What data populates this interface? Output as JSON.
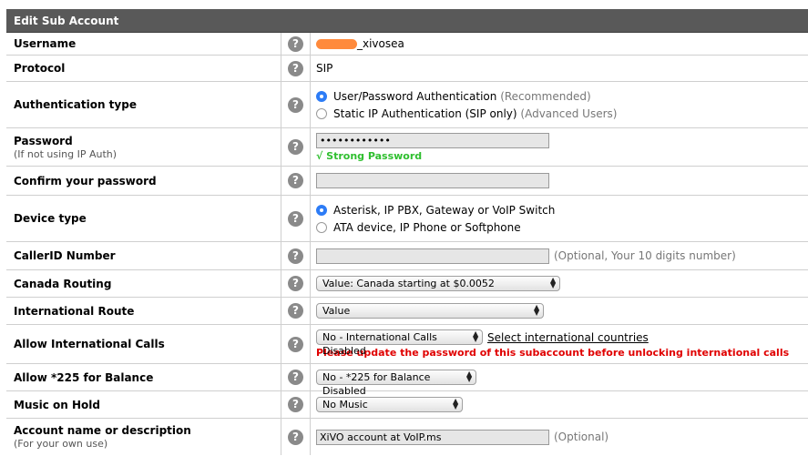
{
  "title": "Edit Sub Account",
  "rows": {
    "username": {
      "label": "Username",
      "value_suffix": "_xivosea"
    },
    "protocol": {
      "label": "Protocol",
      "value": "SIP"
    },
    "auth": {
      "label": "Authentication type",
      "option1": "User/Password Authentication",
      "option1_note": "(Recommended)",
      "option2": "Static IP Authentication (SIP only)",
      "option2_note": "(Advanced Users)"
    },
    "password": {
      "label": "Password",
      "sublabel": "(If not using IP Auth)",
      "value": "••••••••••••",
      "strength": "√ Strong Password"
    },
    "confirm": {
      "label": "Confirm your password",
      "value": ""
    },
    "device": {
      "label": "Device type",
      "option1": "Asterisk, IP PBX, Gateway or VoIP Switch",
      "option2": "ATA device, IP Phone or Softphone"
    },
    "callerid": {
      "label": "CallerID Number",
      "value": "",
      "hint": "(Optional, Your 10 digits number)"
    },
    "canada": {
      "label": "Canada Routing",
      "selected": "Value: Canada starting at $0.0052"
    },
    "intl_route": {
      "label": "International Route",
      "selected": "Value"
    },
    "intl_calls": {
      "label": "Allow International Calls",
      "selected": "No - International Calls Disabled",
      "link": "Select international countries",
      "warning": "Please update the password of this subaccount before unlocking international calls"
    },
    "balance": {
      "label": "Allow *225 for Balance",
      "selected": "No - *225 for Balance Disabled"
    },
    "moh": {
      "label": "Music on Hold",
      "selected": "No Music"
    },
    "desc": {
      "label": "Account name or description",
      "sublabel": "(For your own use)",
      "value": "XiVO account at VoIP.ms",
      "hint": "(Optional)"
    }
  },
  "help_glyph": "?",
  "colors": {
    "header_bg": "#595959",
    "radio_selected": "#2d7cf6",
    "strong": "#2fbf2f",
    "warning": "#e00000"
  }
}
